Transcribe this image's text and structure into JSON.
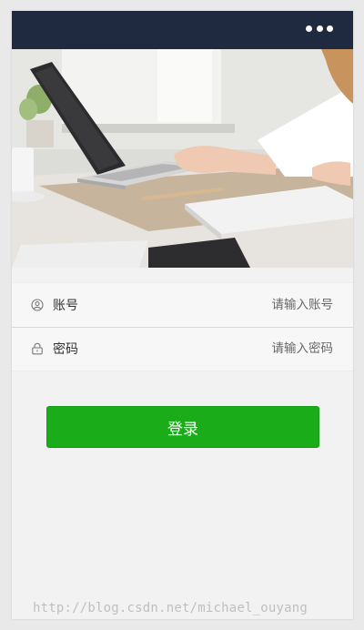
{
  "header": {
    "menu_icon": "more-horizontal-icon"
  },
  "hero": {
    "image_alt": "laptop-on-desk-photo"
  },
  "form": {
    "account": {
      "icon": "user-circle-icon",
      "label": "账号",
      "placeholder": "请输入账号"
    },
    "password": {
      "icon": "lock-icon",
      "label": "密码",
      "placeholder": "请输入密码"
    }
  },
  "login_button": {
    "label": "登录",
    "color": "#1aad19"
  },
  "watermark": "http://blog.csdn.net/michael_ouyang",
  "colors": {
    "navbar": "#1f2940",
    "background": "#f2f2f2",
    "primary": "#1aad19"
  }
}
